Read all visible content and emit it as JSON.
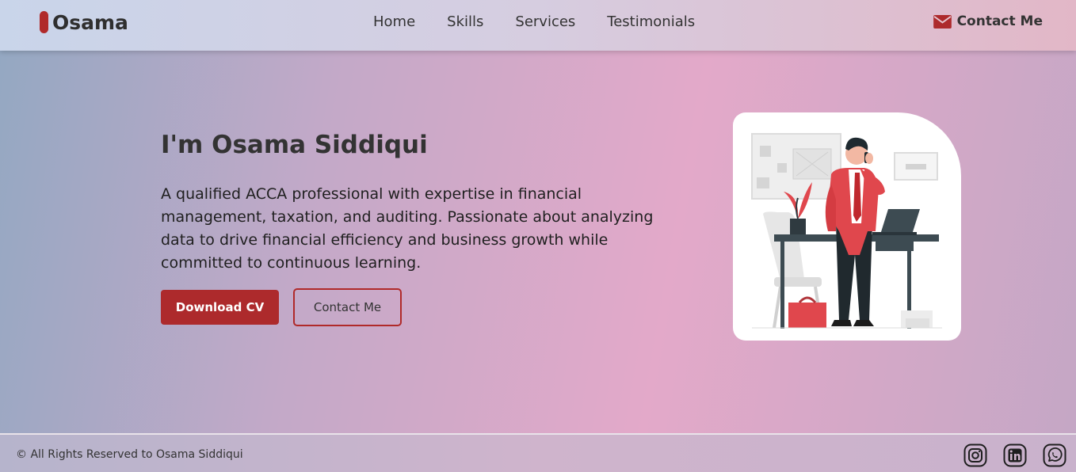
{
  "header": {
    "logo_text": "Osama",
    "nav": [
      "Home",
      "Skills",
      "Services",
      "Testimonials"
    ],
    "contact_label": "Contact Me",
    "contact_icon": "envelope-icon"
  },
  "hero": {
    "title": "I'm Osama Siddiqui",
    "description": "A qualified ACCA professional with expertise in financial management, taxation, and auditing. Passionate about analyzing data to drive financial efficiency and business growth while committed to continuous learning.",
    "download_label": "Download CV",
    "contact_label": "Contact Me"
  },
  "footer": {
    "copyright": "© All Rights Reserved to Osama Siddiqui",
    "social_icons": [
      "instagram-icon",
      "linkedin-icon",
      "whatsapp-icon"
    ]
  },
  "colors": {
    "accent": "#ad2a2c",
    "text": "#2e2e2e"
  }
}
